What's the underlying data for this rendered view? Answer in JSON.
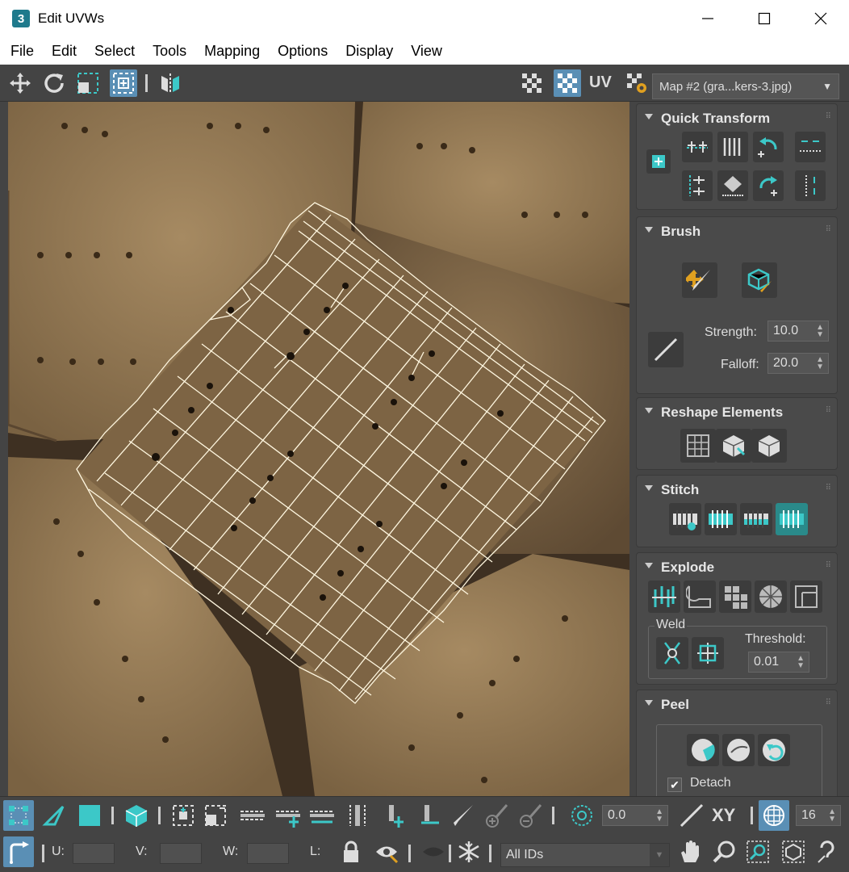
{
  "window": {
    "title": "Edit UVWs",
    "app_icon_label": "3"
  },
  "menu": [
    "File",
    "Edit",
    "Select",
    "Tools",
    "Mapping",
    "Options",
    "Display",
    "View"
  ],
  "toolbar_top": {
    "uv_label": "UV",
    "map_dropdown": "Map #2 (gra...kers-3.jpg)"
  },
  "panel": {
    "quick_transform": {
      "title": "Quick Transform"
    },
    "brush": {
      "title": "Brush",
      "strength_label": "Strength:",
      "strength_value": "10.0",
      "falloff_label": "Falloff:",
      "falloff_value": "20.0"
    },
    "reshape": {
      "title": "Reshape Elements"
    },
    "stitch": {
      "title": "Stitch"
    },
    "explode": {
      "title": "Explode",
      "weld_label": "Weld",
      "threshold_label": "Threshold:",
      "threshold_value": "0.01"
    },
    "peel": {
      "title": "Peel",
      "detach_label": "Detach",
      "detach_checked": true
    }
  },
  "bottom1": {
    "rotate_value": "0.0",
    "xy_label": "XY",
    "grid_value": "16"
  },
  "bottom2": {
    "u_label": "U:",
    "v_label": "V:",
    "w_label": "W:",
    "l_label": "L:",
    "ids_dropdown": "All IDs"
  },
  "colors": {
    "accent": "#3cc8c8",
    "active": "#5a8fb5",
    "panel_bg": "#444444"
  }
}
